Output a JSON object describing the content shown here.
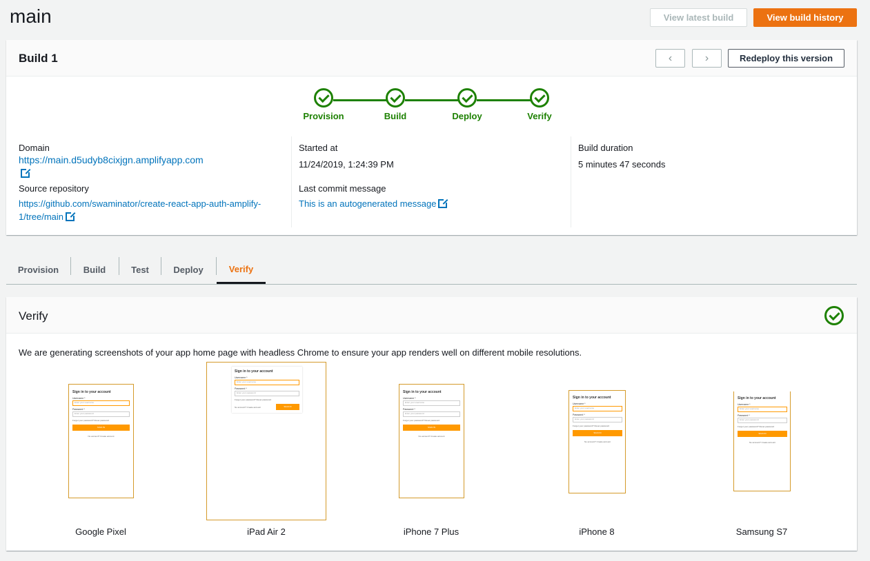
{
  "header": {
    "title": "main",
    "view_latest_label": "View latest build",
    "view_history_label": "View build history"
  },
  "build": {
    "title": "Build 1",
    "prev_icon": "chevron-left-icon",
    "next_icon": "chevron-right-icon",
    "redeploy_label": "Redeploy this version",
    "steps": [
      {
        "label": "Provision",
        "status": "complete"
      },
      {
        "label": "Build",
        "status": "complete"
      },
      {
        "label": "Deploy",
        "status": "complete"
      },
      {
        "label": "Verify",
        "status": "complete"
      }
    ],
    "domain_label": "Domain",
    "domain_link": "https://main.d5udyb8cixjgn.amplifyapp.com",
    "source_label": "Source repository",
    "source_link_line1": "https://github.com/swaminator/create-react-app-auth-amplify-",
    "source_link_line2": "1/tree/main",
    "started_label": "Started at",
    "started_value": "11/24/2019, 1:24:39 PM",
    "commit_label": "Last commit message",
    "commit_link": "This is an autogenerated message",
    "duration_label": "Build duration",
    "duration_value": "5 minutes 47 seconds"
  },
  "tabs": [
    {
      "label": "Provision"
    },
    {
      "label": "Build"
    },
    {
      "label": "Test"
    },
    {
      "label": "Deploy"
    },
    {
      "label": "Verify",
      "active": true
    }
  ],
  "verify": {
    "title": "Verify",
    "description": "We are generating screenshots of your app home page with headless Chrome to ensure your app renders well on different mobile resolutions.",
    "devices": [
      {
        "name": "Google Pixel"
      },
      {
        "name": "iPad Air 2"
      },
      {
        "name": "iPhone 7 Plus"
      },
      {
        "name": "iPhone 8"
      },
      {
        "name": "Samsung S7"
      }
    ],
    "mini_form": {
      "title": "Sign in to your account",
      "username_label": "Username *",
      "username_placeholder": "Enter your username",
      "password_label": "Password *",
      "password_placeholder": "Enter your password",
      "forgot_text": "Forget your password? Reset password",
      "signin_label": "SIGN IN",
      "footer_text": "No account? Create account"
    }
  },
  "colors": {
    "accent": "#ec7211",
    "success": "#1d8102",
    "link": "#0073bb"
  }
}
